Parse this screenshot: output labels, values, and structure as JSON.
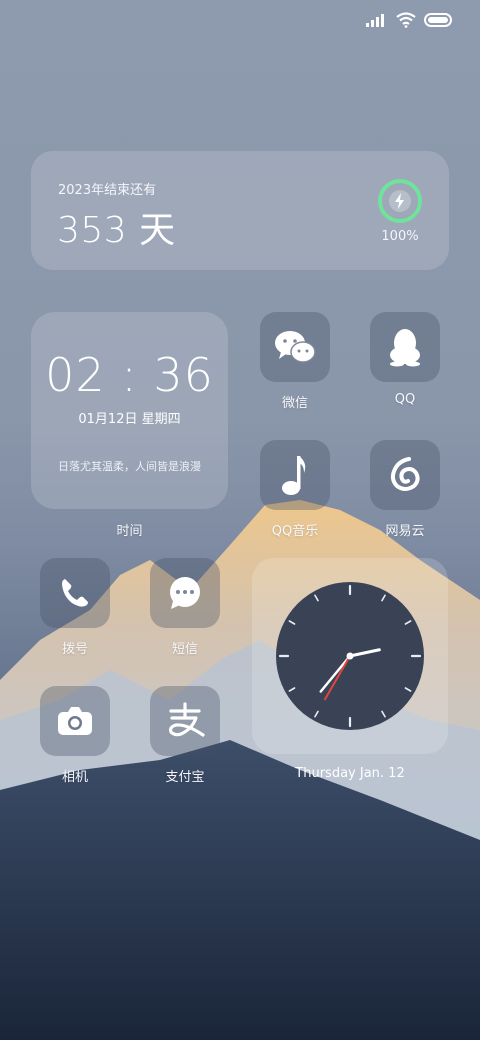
{
  "status": {
    "signal_icon": "signal-icon",
    "wifi_icon": "wifi-icon",
    "battery_icon": "battery-icon"
  },
  "countdown": {
    "label": "2023年结束还有",
    "days": "353 天",
    "battery_pct": "100%",
    "ring_color": "#6fe39a"
  },
  "time_widget": {
    "time": "02 : 36",
    "date": "01月12日    星期四",
    "quote": "日落尤其温柔，人间皆是浪漫",
    "label": "时间"
  },
  "apps": {
    "wechat": "微信",
    "qq": "QQ",
    "qqmusic": "QQ音乐",
    "netease": "网易云",
    "dialer": "拨号",
    "sms": "短信",
    "camera": "相机",
    "alipay": "支付宝"
  },
  "analog_clock": {
    "hour": 2,
    "minute": 36,
    "second": 35,
    "date_label": "Thursday  Jan. 12"
  }
}
